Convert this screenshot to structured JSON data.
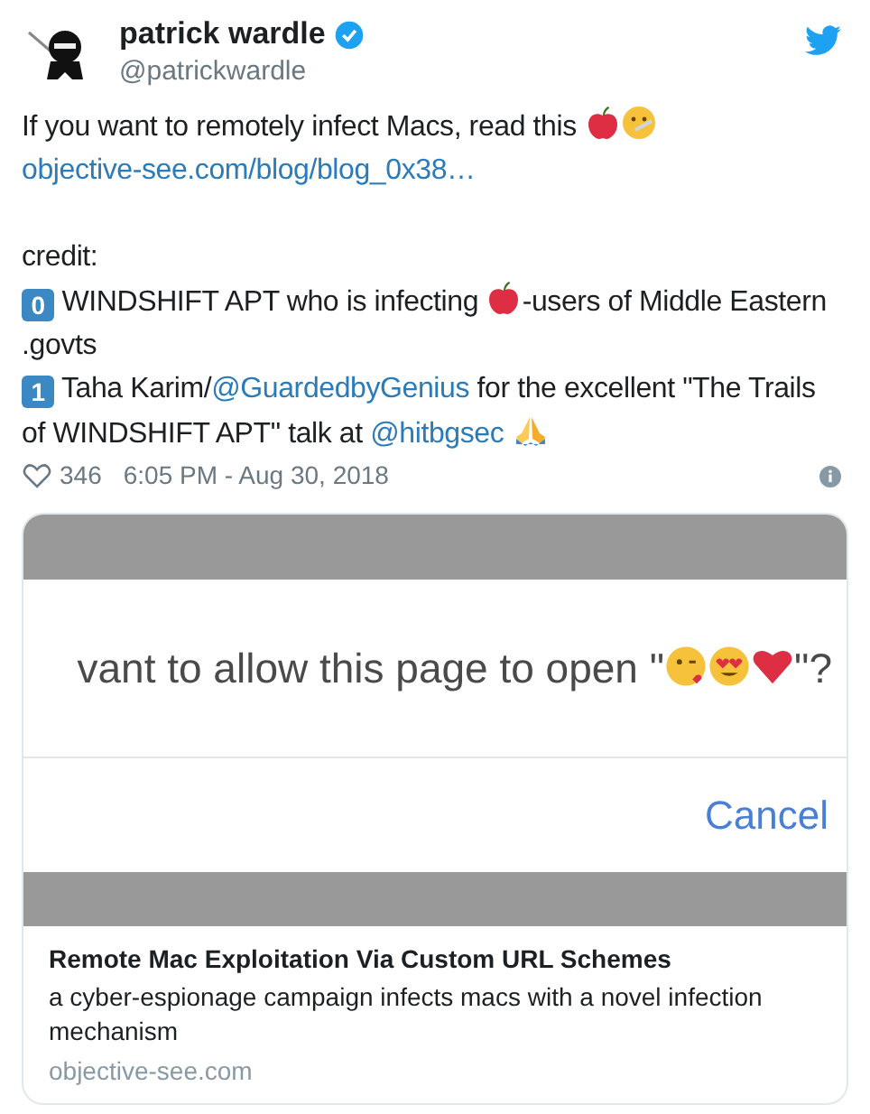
{
  "author": {
    "name": "patrick wardle",
    "handle": "@patrickwardle",
    "verified": true
  },
  "tweet": [
    [
      {
        "kind": "text",
        "text": "If you want to remotely infect Macs, read this "
      },
      {
        "kind": "apple"
      },
      {
        "kind": "sick-face"
      },
      {
        "kind": "link",
        "text": "objective-see.com/blog/blog_0x38…"
      }
    ],
    [
      {
        "kind": "text",
        "text": "credit:"
      }
    ],
    [
      {
        "kind": "keycap",
        "text": "0"
      },
      {
        "kind": "text",
        "text": " WINDSHIFT APT who is infecting "
      },
      {
        "kind": "apple"
      },
      {
        "kind": "text",
        "text": "-users of Middle Eastern .govts"
      }
    ],
    [
      {
        "kind": "keycap",
        "text": "1"
      },
      {
        "kind": "text",
        "text": " Taha Karim/"
      },
      {
        "kind": "link",
        "text": "@GuardedbyGenius"
      },
      {
        "kind": "text",
        "text": " for the excellent \"The Trails of WINDSHIFT APT\" talk at "
      },
      {
        "kind": "link",
        "text": "@hitbgsec"
      },
      {
        "kind": "pray"
      }
    ]
  ],
  "likes": "346",
  "time": "6:05 PM - Aug 30, 2018",
  "card": {
    "dialog": [
      {
        "kind": "text",
        "text": "vant to allow this page to open \""
      },
      {
        "kind": "kiss-face"
      },
      {
        "kind": "heart-eyes"
      },
      {
        "kind": "heart"
      },
      {
        "kind": "text",
        "text": "\"?"
      }
    ],
    "cancel": "Cancel",
    "title": "Remote Mac Exploitation Via Custom URL Schemes",
    "description": "a cyber-espionage campaign infects macs with a novel infection mechanism",
    "domain": "objective-see.com"
  }
}
